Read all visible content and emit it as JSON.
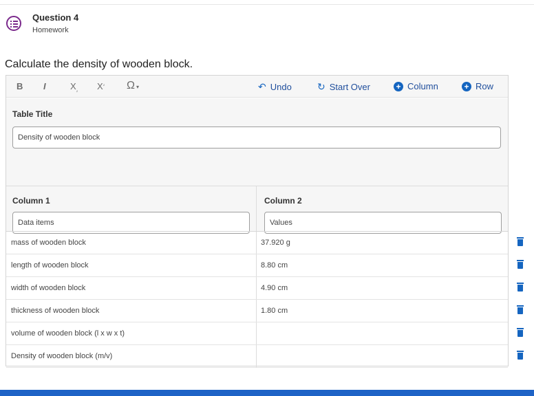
{
  "question": {
    "title": "Question 4",
    "subtitle": "Homework",
    "icon": "list-icon",
    "accent": "#7b2a8c"
  },
  "prompt": "Calculate the density of wooden block.",
  "toolbar": {
    "bold": "B",
    "italic": "I",
    "subscript": "X",
    "superscript": "X",
    "omega": "Ω",
    "undo": "Undo",
    "start_over": "Start Over",
    "add_column": "Column",
    "add_row": "Row",
    "button_color": "#1565c0"
  },
  "table_title": {
    "label": "Table Title",
    "value": "Density of wooden block"
  },
  "columns": [
    {
      "label": "Column 1",
      "value": "Data items"
    },
    {
      "label": "Column 2",
      "value": "Values"
    }
  ],
  "rows": [
    {
      "item": "mass of wooden block",
      "value": "37.920 g"
    },
    {
      "item": "length of wooden block",
      "value": "8.80 cm"
    },
    {
      "item": "width of wooden block",
      "value": "4.90 cm"
    },
    {
      "item": "thickness of wooden block",
      "value": "1.80 cm"
    },
    {
      "item": "volume of wooden block  (l x w x t)",
      "value": ""
    },
    {
      "item": "Density of wooden block (m/v)",
      "value": ""
    }
  ]
}
